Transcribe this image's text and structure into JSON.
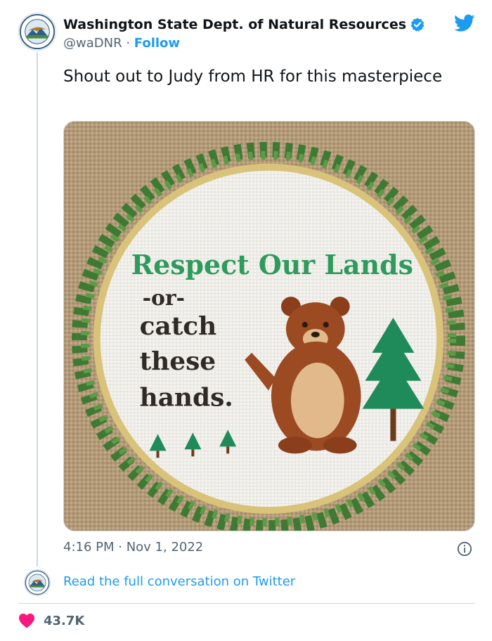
{
  "account": {
    "display_name": "Washington State Dept. of Natural Resources",
    "handle": "@waDNR",
    "separator": " · ",
    "follow_label": "Follow",
    "avatar_icon": "dnr-seal-icon",
    "verified_icon": "verified-badge-icon"
  },
  "tweet": {
    "text": "Shout out to Judy from HR for this masterpiece",
    "time": "4:16 PM",
    "date_separator": " · ",
    "date": "Nov 1, 2022"
  },
  "media": {
    "description_icon": "cross-stitch-photo",
    "stitch_line1": "Respect Our Lands",
    "stitch_line2": "-or-",
    "stitch_line3": "catch",
    "stitch_line4": "these",
    "stitch_line5": "hands."
  },
  "conversation": {
    "link_text": "Read the full conversation on Twitter"
  },
  "engagement": {
    "likes": "43.7K"
  },
  "colors": {
    "brand_blue": "#1d9bf0",
    "heart": "#f91880",
    "text_secondary": "#536471"
  }
}
